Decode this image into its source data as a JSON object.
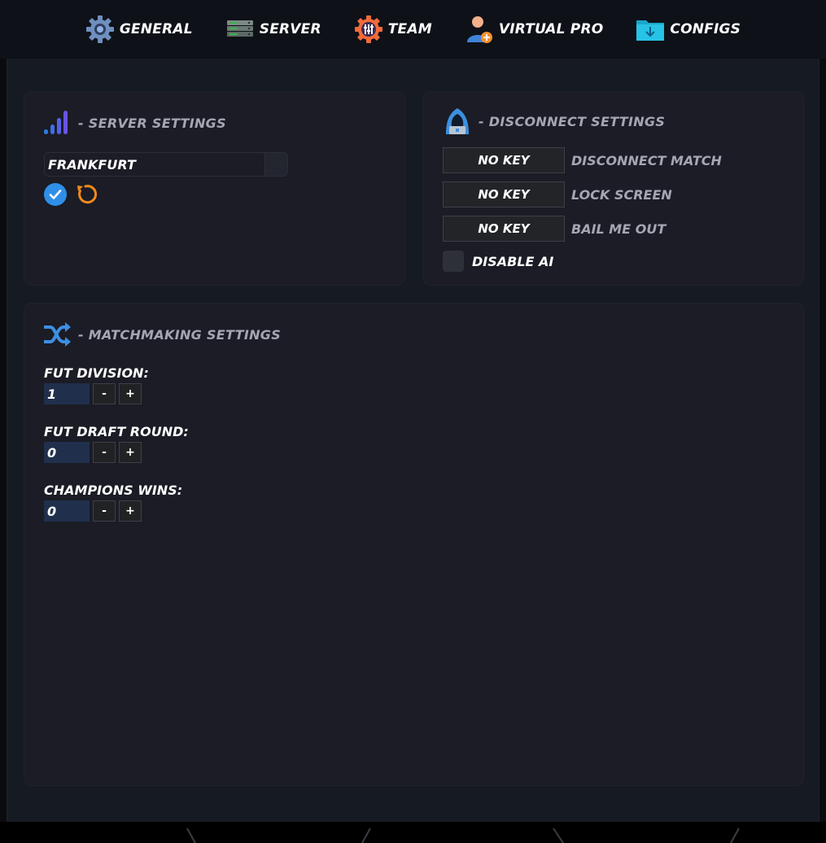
{
  "nav": {
    "items": [
      {
        "label": "General",
        "icon": "gear-icon"
      },
      {
        "label": "Server",
        "icon": "server-rack-icon"
      },
      {
        "label": "Team",
        "icon": "team-gear-icon"
      },
      {
        "label": "Virtual Pro",
        "icon": "user-add-icon"
      },
      {
        "label": "Configs",
        "icon": "folder-download-icon"
      }
    ]
  },
  "server_panel": {
    "title": "- Server Settings",
    "icon": "signal-bars-icon",
    "selected_server": "FRANKFURT",
    "confirm_icon": "check-circle-icon",
    "reset_icon": "refresh-icon"
  },
  "disconnect_panel": {
    "title": "- Disconnect Settings",
    "icon": "hooded-hacker-icon",
    "binds": [
      {
        "key": "NO KEY",
        "label": "Disconnect Match"
      },
      {
        "key": "NO KEY",
        "label": "Lock Screen"
      },
      {
        "key": "NO KEY",
        "label": "Bail Me Out"
      }
    ],
    "disable_ai_label": "Disable AI",
    "disable_ai_checked": false
  },
  "matchmaking_panel": {
    "title": "- Matchmaking Settings",
    "icon": "shuffle-icon",
    "fields": [
      {
        "label": "FUT Division:",
        "value": "1"
      },
      {
        "label": "FUT Draft Round:",
        "value": "0"
      },
      {
        "label": "Champions Wins:",
        "value": "0"
      }
    ],
    "minus": "-",
    "plus": "+"
  },
  "colors": {
    "accent_blue": "#2f8fe8",
    "accent_orange": "#f08a1c",
    "panel_bg": "#1b1c25",
    "muted_text": "#a4a6b3"
  }
}
